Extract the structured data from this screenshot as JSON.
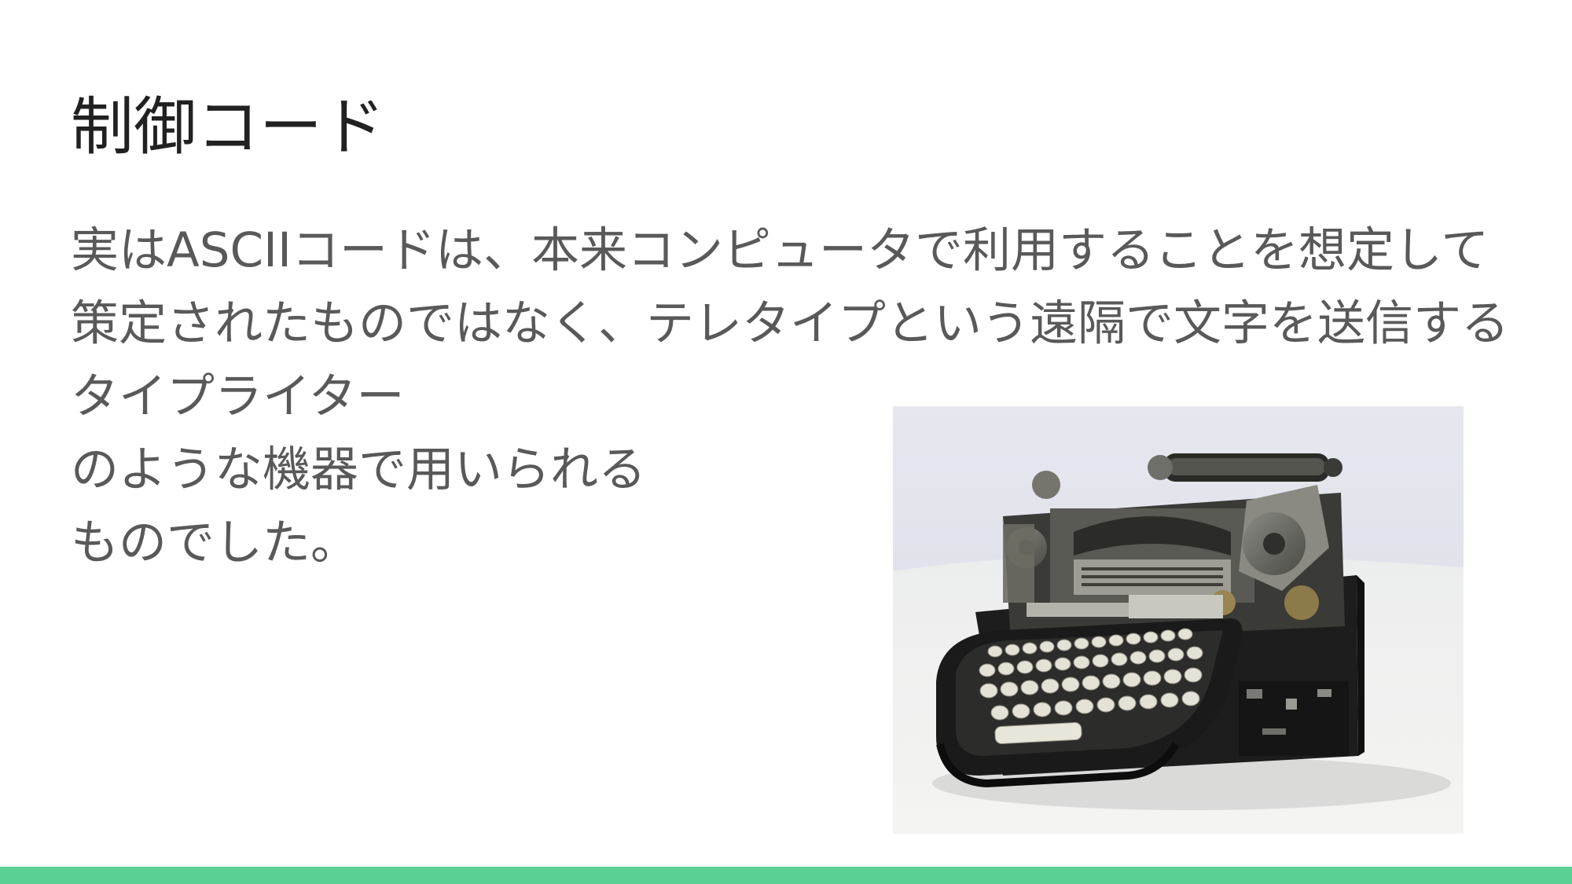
{
  "slide": {
    "title": "制御コード",
    "body_lines": [
      "実はASCIIコードは、本来コンピュータで利用することを想定して",
      "策定されたものではなく、テレタイプという遠隔で文字を送信する",
      "タイプライター",
      "のような機器で用いられる",
      "ものでした。"
    ],
    "image_subject": "teletype-machine"
  },
  "colors": {
    "title": "#212121",
    "body_text": "#595959",
    "accent_bar": "#5ccf94",
    "background": "#ffffff"
  }
}
